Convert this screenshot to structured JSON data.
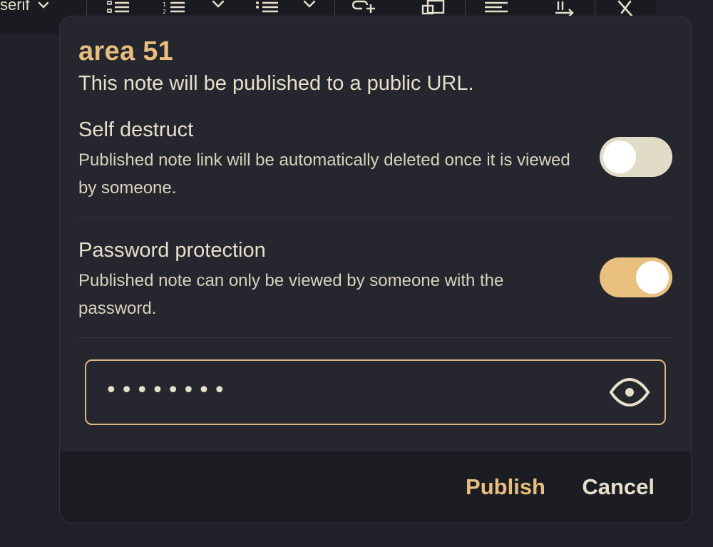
{
  "toolbar": {
    "font_label": "serif",
    "icons": [
      "chevron-down-icon",
      "bulleted-list-icon",
      "numbered-list-icon",
      "chevron-down-icon",
      "checklist-icon",
      "chevron-down-icon",
      "add-link-icon",
      "embed-icon",
      "align-left-icon",
      "text-direction-icon",
      "clear-format-icon"
    ]
  },
  "dialog": {
    "title": "area 51",
    "subtitle": "This note will be published to a public URL.",
    "self_destruct": {
      "title": "Self destruct",
      "description": "Published note link will be automatically deleted once it is viewed by someone.",
      "enabled": false
    },
    "password_protection": {
      "title": "Password protection",
      "description": "Published note can only be viewed by someone with the password.",
      "enabled": true
    },
    "password_field": {
      "masked_value": "••••••••"
    },
    "publish_label": "Publish",
    "cancel_label": "Cancel"
  },
  "colors": {
    "accent": "#e8be7e",
    "background": "#202129",
    "dialog": "#25262e",
    "footer": "#1c1d23",
    "text": "#e6dfcb"
  }
}
